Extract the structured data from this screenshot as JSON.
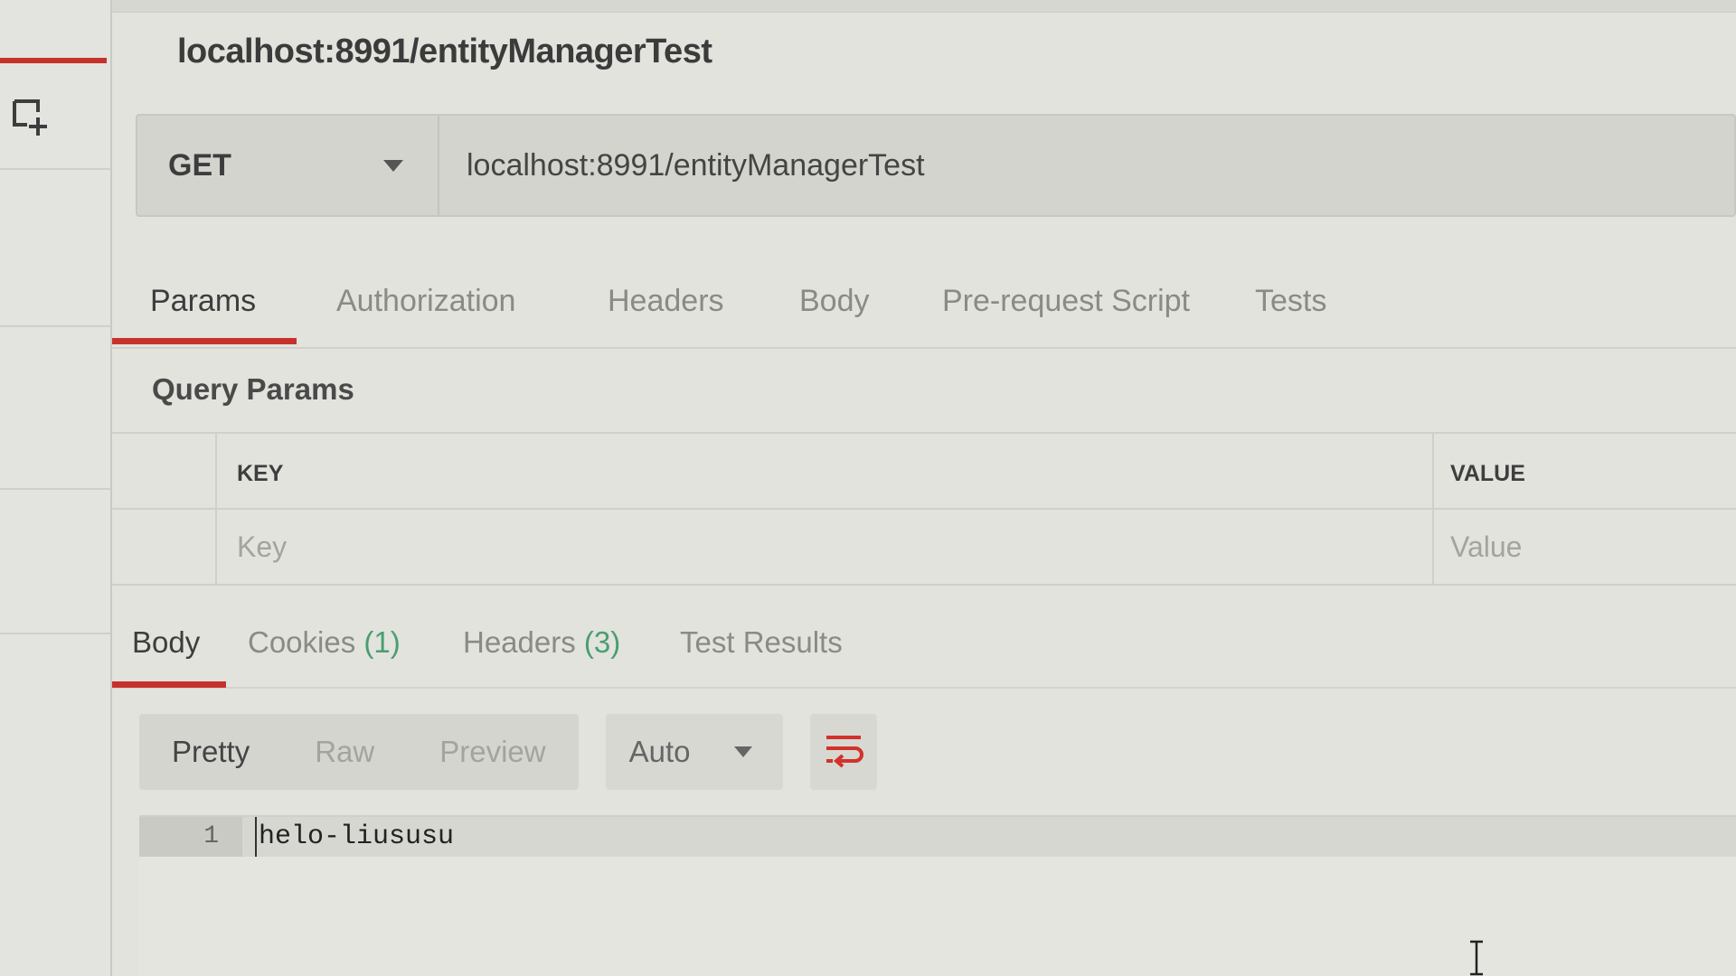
{
  "request": {
    "title": "localhost:8991/entityManagerTest",
    "method": "GET",
    "url": "localhost:8991/entityManagerTest"
  },
  "request_tabs": [
    {
      "label": "Params",
      "active": true
    },
    {
      "label": "Authorization",
      "active": false
    },
    {
      "label": "Headers",
      "active": false
    },
    {
      "label": "Body",
      "active": false
    },
    {
      "label": "Pre-request Script",
      "active": false
    },
    {
      "label": "Tests",
      "active": false
    }
  ],
  "query_params": {
    "title": "Query Params",
    "columns": {
      "key": "KEY",
      "value": "VALUE"
    },
    "placeholders": {
      "key": "Key",
      "value": "Value"
    }
  },
  "response_tabs": [
    {
      "label": "Body",
      "count": "",
      "active": true
    },
    {
      "label": "Cookies",
      "count": "(1)",
      "active": false
    },
    {
      "label": "Headers",
      "count": "(3)",
      "active": false
    },
    {
      "label": "Test Results",
      "count": "",
      "active": false
    }
  ],
  "response_toolbar": {
    "views": [
      {
        "label": "Pretty",
        "active": true
      },
      {
        "label": "Raw",
        "active": false
      },
      {
        "label": "Preview",
        "active": false
      }
    ],
    "format": "Auto",
    "wrap_icon": "wrap-lines-icon"
  },
  "response_body": {
    "lines": [
      {
        "number": "1",
        "text": "helo-liususu"
      }
    ]
  },
  "colors": {
    "accent": "#c8312b",
    "count_green": "#4a9e70",
    "background": "#e2e3dd"
  },
  "icons": {
    "new_tab": "new-tab-plus-icon",
    "method_dropdown": "chevron-down-icon",
    "format_dropdown": "chevron-down-icon"
  }
}
